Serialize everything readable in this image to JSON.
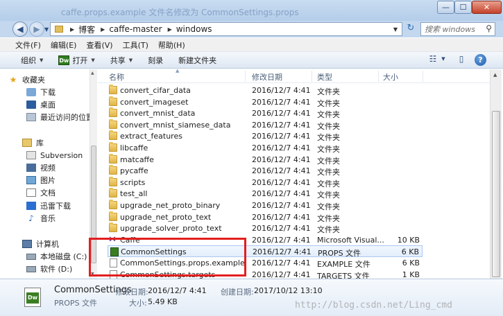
{
  "window": {
    "faded_title": "caffe.props.example 文件名修改为 CommonSettings.props",
    "btn_min": "—",
    "btn_max": "☐",
    "btn_close": "✕"
  },
  "address": {
    "crumbs": [
      "博客",
      "caffe-master",
      "windows"
    ],
    "search_placeholder": "搜索 windows"
  },
  "menu": [
    "文件(F)",
    "编辑(E)",
    "查看(V)",
    "工具(T)",
    "帮助(H)"
  ],
  "toolbar": {
    "organize": "组织",
    "open": "打开",
    "share": "共享",
    "burn": "刻录",
    "new_folder": "新建文件夹",
    "dw_badge": "Dw"
  },
  "nav": {
    "favorites": "收藏夹",
    "downloads": "下载",
    "desktop": "桌面",
    "recent": "最近访问的位置",
    "libraries": "库",
    "subversion": "Subversion",
    "videos": "视频",
    "pictures": "图片",
    "documents": "文档",
    "thunder": "迅雷下载",
    "music": "音乐",
    "computer": "计算机",
    "drive_c": "本地磁盘 (C:)",
    "drive_d": "软件 (D:)"
  },
  "columns": {
    "name": "名称",
    "modified": "修改日期",
    "type": "类型",
    "size": "大小"
  },
  "files": [
    {
      "name": "convert_cifar_data",
      "date": "2016/12/7 4:41",
      "type": "文件夹",
      "size": "",
      "icon": "folder-icon"
    },
    {
      "name": "convert_imageset",
      "date": "2016/12/7 4:41",
      "type": "文件夹",
      "size": "",
      "icon": "folder-icon"
    },
    {
      "name": "convert_mnist_data",
      "date": "2016/12/7 4:41",
      "type": "文件夹",
      "size": "",
      "icon": "folder-icon"
    },
    {
      "name": "convert_mnist_siamese_data",
      "date": "2016/12/7 4:41",
      "type": "文件夹",
      "size": "",
      "icon": "folder-icon"
    },
    {
      "name": "extract_features",
      "date": "2016/12/7 4:41",
      "type": "文件夹",
      "size": "",
      "icon": "folder-icon"
    },
    {
      "name": "libcaffe",
      "date": "2016/12/7 4:41",
      "type": "文件夹",
      "size": "",
      "icon": "folder-icon"
    },
    {
      "name": "matcaffe",
      "date": "2016/12/7 4:41",
      "type": "文件夹",
      "size": "",
      "icon": "folder-icon"
    },
    {
      "name": "pycaffe",
      "date": "2016/12/7 4:41",
      "type": "文件夹",
      "size": "",
      "icon": "folder-icon"
    },
    {
      "name": "scripts",
      "date": "2016/12/7 4:41",
      "type": "文件夹",
      "size": "",
      "icon": "folder-icon"
    },
    {
      "name": "test_all",
      "date": "2016/12/7 4:41",
      "type": "文件夹",
      "size": "",
      "icon": "folder-icon"
    },
    {
      "name": "upgrade_net_proto_binary",
      "date": "2016/12/7 4:41",
      "type": "文件夹",
      "size": "",
      "icon": "folder-icon"
    },
    {
      "name": "upgrade_net_proto_text",
      "date": "2016/12/7 4:41",
      "type": "文件夹",
      "size": "",
      "icon": "folder-icon"
    },
    {
      "name": "upgrade_solver_proto_text",
      "date": "2016/12/7 4:41",
      "type": "文件夹",
      "size": "",
      "icon": "folder-icon"
    },
    {
      "name": "Caffe",
      "date": "2016/12/7 4:41",
      "type": "Microsoft Visual...",
      "size": "10 KB",
      "icon": "solution-icon"
    },
    {
      "name": "CommonSettings",
      "date": "2016/12/7 4:41",
      "type": "PROPS 文件",
      "size": "6 KB",
      "icon": "props-file-icon"
    },
    {
      "name": "CommonSettings.props.example",
      "date": "2016/12/7 4:41",
      "type": "EXAMPLE 文件",
      "size": "6 KB",
      "icon": "file-icon"
    },
    {
      "name": "CommonSettings.targets",
      "date": "2016/12/7 4:41",
      "type": "TARGETS 文件",
      "size": "1 KB",
      "icon": "file-icon"
    }
  ],
  "details": {
    "name": "CommonSettings",
    "modified_label": "修改日期:",
    "modified": "2016/12/7 4:41",
    "created_label": "创建日期:",
    "created": "2017/10/12 13:10",
    "type": "PROPS 文件",
    "size_label": "大小:",
    "size": "5.49 KB",
    "watermark": "http://blog.csdn.net/Ling_cmd"
  }
}
